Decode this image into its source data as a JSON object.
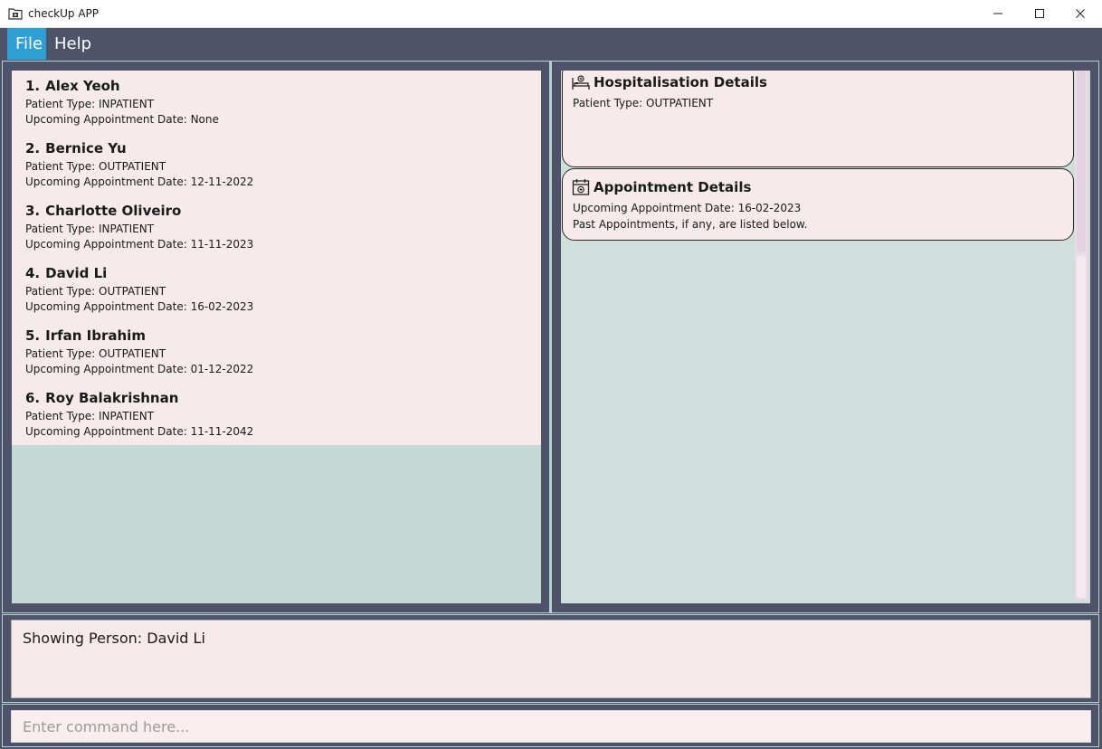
{
  "window": {
    "title": "checkUp APP",
    "controls": [
      "minimize-icon",
      "maximize-icon",
      "close-icon"
    ]
  },
  "menu": {
    "file": "File",
    "help": "Help",
    "accent_color": "#2d9fd3"
  },
  "patients": [
    {
      "index": "1.",
      "name": "Alex Yeoh",
      "type": "Patient Type: INPATIENT",
      "appointment": "Upcoming Appointment Date: None"
    },
    {
      "index": "2.",
      "name": "Bernice Yu",
      "type": "Patient Type: OUTPATIENT",
      "appointment": "Upcoming Appointment Date: 12-11-2022"
    },
    {
      "index": "3.",
      "name": "Charlotte Oliveiro",
      "type": "Patient Type: INPATIENT",
      "appointment": "Upcoming Appointment Date: 11-11-2023"
    },
    {
      "index": "4.",
      "name": "David Li",
      "type": "Patient Type: OUTPATIENT",
      "appointment": "Upcoming Appointment Date: 16-02-2023"
    },
    {
      "index": "5.",
      "name": "Irfan Ibrahim",
      "type": "Patient Type: OUTPATIENT",
      "appointment": "Upcoming Appointment Date: 01-12-2022"
    },
    {
      "index": "6.",
      "name": "Roy Balakrishnan",
      "type": "Patient Type: INPATIENT",
      "appointment": "Upcoming Appointment Date: 11-11-2042"
    }
  ],
  "details": {
    "hospitalisation": {
      "title": "Hospitalisation Details",
      "icon": "hospital-bed-icon",
      "patient_type": "Patient Type: OUTPATIENT"
    },
    "appointment": {
      "title": "Appointment Details",
      "icon": "calendar-icon",
      "upcoming": "Upcoming Appointment Date: 16-02-2023",
      "past_note": "Past Appointments, if any, are listed below."
    }
  },
  "result": {
    "text": "Showing Person: David Li"
  },
  "command": {
    "placeholder": "Enter command here...",
    "value": ""
  },
  "colors": {
    "background": "#4f5369",
    "card": "#f6eaea",
    "list_empty": "#c5d9d5",
    "detail_empty": "#d1dfdc"
  }
}
